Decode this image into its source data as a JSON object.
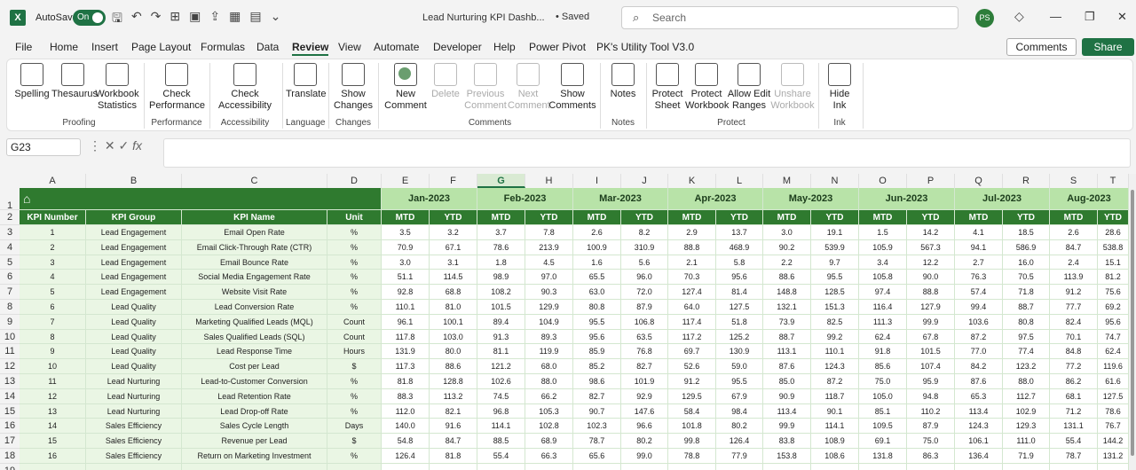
{
  "app": {
    "logo": "X",
    "autosave_label": "AutoSave",
    "autosave_state": "On",
    "title": "Lead Nurturing KPI Dashb...",
    "saved": "• Saved",
    "search_placeholder": "Search",
    "avatar": "PS"
  },
  "tabs": [
    "File",
    "Home",
    "Insert",
    "Page Layout",
    "Formulas",
    "Data",
    "Review",
    "View",
    "Automate",
    "Developer",
    "Help",
    "Power Pivot",
    "PK's Utility Tool V3.0"
  ],
  "active_tab": "Review",
  "comments_btn": "Comments",
  "share_btn": "Share",
  "ribbon": {
    "spelling": "Spelling",
    "thesaurus": "Thesaurus",
    "workbook_stats": "Workbook Statistics",
    "check_perf": "Check Performance",
    "check_access": "Check Accessibility",
    "translate": "Translate",
    "show_changes": "Show Changes",
    "new_comment": "New Comment",
    "delete": "Delete",
    "prev_comment": "Previous Comment",
    "next_comment": "Next Comment",
    "show_comments": "Show Comments",
    "notes": "Notes",
    "protect_sheet": "Protect Sheet",
    "protect_workbook": "Protect Workbook",
    "allow_edit": "Allow Edit Ranges",
    "unshare": "Unshare Workbook",
    "hide_ink": "Hide Ink",
    "groups": {
      "proofing": "Proofing",
      "performance": "Performance",
      "accessibility": "Accessibility",
      "language": "Language",
      "changes": "Changes",
      "comments": "Comments",
      "notes": "Notes",
      "protect": "Protect",
      "ink": "Ink"
    }
  },
  "name_box": "G23",
  "fx": "fx",
  "columns": [
    "A",
    "B",
    "C",
    "D",
    "E",
    "F",
    "G",
    "H",
    "I",
    "J",
    "K",
    "L",
    "M",
    "N",
    "O",
    "P",
    "Q",
    "R",
    "S",
    "T"
  ],
  "selected_column": "G",
  "months": [
    "Jan-2023",
    "Feb-2023",
    "Mar-2023",
    "Apr-2023",
    "May-2023",
    "Jun-2023",
    "Jul-2023",
    "Aug-2023"
  ],
  "headers": {
    "kpi_number": "KPI Number",
    "kpi_group": "KPI Group",
    "kpi_name": "KPI Name",
    "unit": "Unit",
    "mtd": "MTD",
    "ytd": "YTD"
  },
  "rows": [
    [
      1,
      "Lead Engagement",
      "Email Open Rate",
      "%",
      "3.5",
      "3.2",
      "3.7",
      "7.8",
      "2.6",
      "8.2",
      "2.9",
      "13.7",
      "3.0",
      "19.1",
      "1.5",
      "14.2",
      "4.1",
      "18.5",
      "2.6",
      "28.6"
    ],
    [
      2,
      "Lead Engagement",
      "Email Click-Through Rate (CTR)",
      "%",
      "70.9",
      "67.1",
      "78.6",
      "213.9",
      "100.9",
      "310.9",
      "88.8",
      "468.9",
      "90.2",
      "539.9",
      "105.9",
      "567.3",
      "94.1",
      "586.9",
      "84.7",
      "538.8"
    ],
    [
      3,
      "Lead Engagement",
      "Email Bounce Rate",
      "%",
      "3.0",
      "3.1",
      "1.8",
      "4.5",
      "1.6",
      "5.6",
      "2.1",
      "5.8",
      "2.2",
      "9.7",
      "3.4",
      "12.2",
      "2.7",
      "16.0",
      "2.4",
      "15.1"
    ],
    [
      4,
      "Lead Engagement",
      "Social Media Engagement Rate",
      "%",
      "51.1",
      "114.5",
      "98.9",
      "97.0",
      "65.5",
      "96.0",
      "70.3",
      "95.6",
      "88.6",
      "95.5",
      "105.8",
      "90.0",
      "76.3",
      "70.5",
      "113.9",
      "81.2"
    ],
    [
      5,
      "Lead Engagement",
      "Website Visit Rate",
      "%",
      "92.8",
      "68.8",
      "108.2",
      "90.3",
      "63.0",
      "72.0",
      "127.4",
      "81.4",
      "148.8",
      "128.5",
      "97.4",
      "88.8",
      "57.4",
      "71.8",
      "91.2",
      "75.6"
    ],
    [
      6,
      "Lead Quality",
      "Lead Conversion Rate",
      "%",
      "110.1",
      "81.0",
      "101.5",
      "129.9",
      "80.8",
      "87.9",
      "64.0",
      "127.5",
      "132.1",
      "151.3",
      "116.4",
      "127.9",
      "99.4",
      "88.7",
      "77.7",
      "69.2"
    ],
    [
      7,
      "Lead Quality",
      "Marketing Qualified Leads (MQL)",
      "Count",
      "96.1",
      "100.1",
      "89.4",
      "104.9",
      "95.5",
      "106.8",
      "117.4",
      "51.8",
      "73.9",
      "82.5",
      "111.3",
      "99.9",
      "103.6",
      "80.8",
      "82.4",
      "95.6"
    ],
    [
      8,
      "Lead Quality",
      "Sales Qualified Leads (SQL)",
      "Count",
      "117.8",
      "103.0",
      "91.3",
      "89.3",
      "95.6",
      "63.5",
      "117.2",
      "125.2",
      "88.7",
      "99.2",
      "62.4",
      "67.8",
      "87.2",
      "97.5",
      "70.1",
      "74.7"
    ],
    [
      9,
      "Lead Quality",
      "Lead Response Time",
      "Hours",
      "131.9",
      "80.0",
      "81.1",
      "119.9",
      "85.9",
      "76.8",
      "69.7",
      "130.9",
      "113.1",
      "110.1",
      "91.8",
      "101.5",
      "77.0",
      "77.4",
      "84.8",
      "62.4"
    ],
    [
      10,
      "Lead Quality",
      "Cost per Lead",
      "$",
      "117.3",
      "88.6",
      "121.2",
      "68.0",
      "85.2",
      "82.7",
      "52.6",
      "59.0",
      "87.6",
      "124.3",
      "85.6",
      "107.4",
      "84.2",
      "123.2",
      "77.2",
      "119.6"
    ],
    [
      11,
      "Lead Nurturing",
      "Lead-to-Customer Conversion",
      "%",
      "81.8",
      "128.8",
      "102.6",
      "88.0",
      "98.6",
      "101.9",
      "91.2",
      "95.5",
      "85.0",
      "87.2",
      "75.0",
      "95.9",
      "87.6",
      "88.0",
      "86.2",
      "61.6"
    ],
    [
      12,
      "Lead Nurturing",
      "Lead Retention Rate",
      "%",
      "88.3",
      "113.2",
      "74.5",
      "66.2",
      "82.7",
      "92.9",
      "129.5",
      "67.9",
      "90.9",
      "118.7",
      "105.0",
      "94.8",
      "65.3",
      "112.7",
      "68.1",
      "127.5"
    ],
    [
      13,
      "Lead Nurturing",
      "Lead Drop-off Rate",
      "%",
      "112.0",
      "82.1",
      "96.8",
      "105.3",
      "90.7",
      "147.6",
      "58.4",
      "98.4",
      "113.4",
      "90.1",
      "85.1",
      "110.2",
      "113.4",
      "102.9",
      "71.2",
      "78.6"
    ],
    [
      14,
      "Sales Efficiency",
      "Sales Cycle Length",
      "Days",
      "140.0",
      "91.6",
      "114.1",
      "102.8",
      "102.3",
      "96.6",
      "101.8",
      "80.2",
      "99.9",
      "114.1",
      "109.5",
      "87.9",
      "124.3",
      "129.3",
      "131.1",
      "76.7"
    ],
    [
      15,
      "Sales Efficiency",
      "Revenue per Lead",
      "$",
      "54.8",
      "84.7",
      "88.5",
      "68.9",
      "78.7",
      "80.2",
      "99.8",
      "126.4",
      "83.8",
      "108.9",
      "69.1",
      "75.0",
      "106.1",
      "111.0",
      "55.4",
      "144.2"
    ],
    [
      16,
      "Sales Efficiency",
      "Return on Marketing Investment",
      "%",
      "126.4",
      "81.8",
      "55.4",
      "66.3",
      "65.6",
      "99.0",
      "78.8",
      "77.9",
      "153.8",
      "108.6",
      "131.8",
      "86.3",
      "136.4",
      "71.9",
      "78.7",
      "131.2"
    ]
  ]
}
